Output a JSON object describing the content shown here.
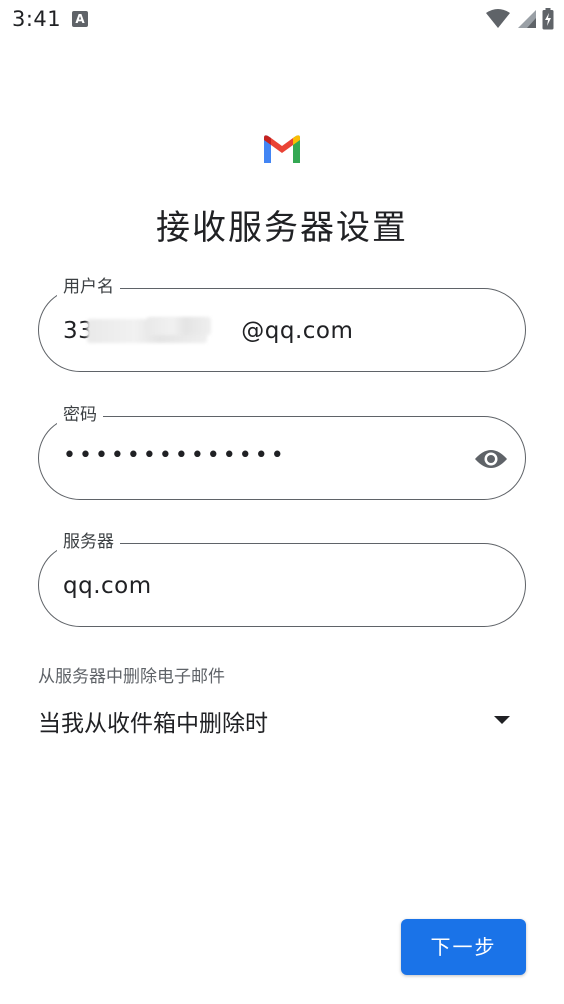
{
  "status_bar": {
    "time": "3:41",
    "notification_icon": "A"
  },
  "header": {
    "logo_icon": "gmail-logo",
    "title": "接收服务器设置"
  },
  "form": {
    "username": {
      "label": "用户名",
      "value_visible_prefix": "33",
      "value_visible_suffix": "@qq.com"
    },
    "password": {
      "label": "密码",
      "value": "••••••••••••••",
      "toggle_icon": "eye-icon"
    },
    "server": {
      "label": "服务器",
      "value": "qq.com"
    },
    "delete_policy": {
      "caption": "从服务器中删除电子邮件",
      "selected": "当我从收件箱中删除时"
    }
  },
  "actions": {
    "next_label": "下一步"
  },
  "colors": {
    "primary": "#1a73e8",
    "outline": "#5f6368",
    "text": "#202124"
  }
}
